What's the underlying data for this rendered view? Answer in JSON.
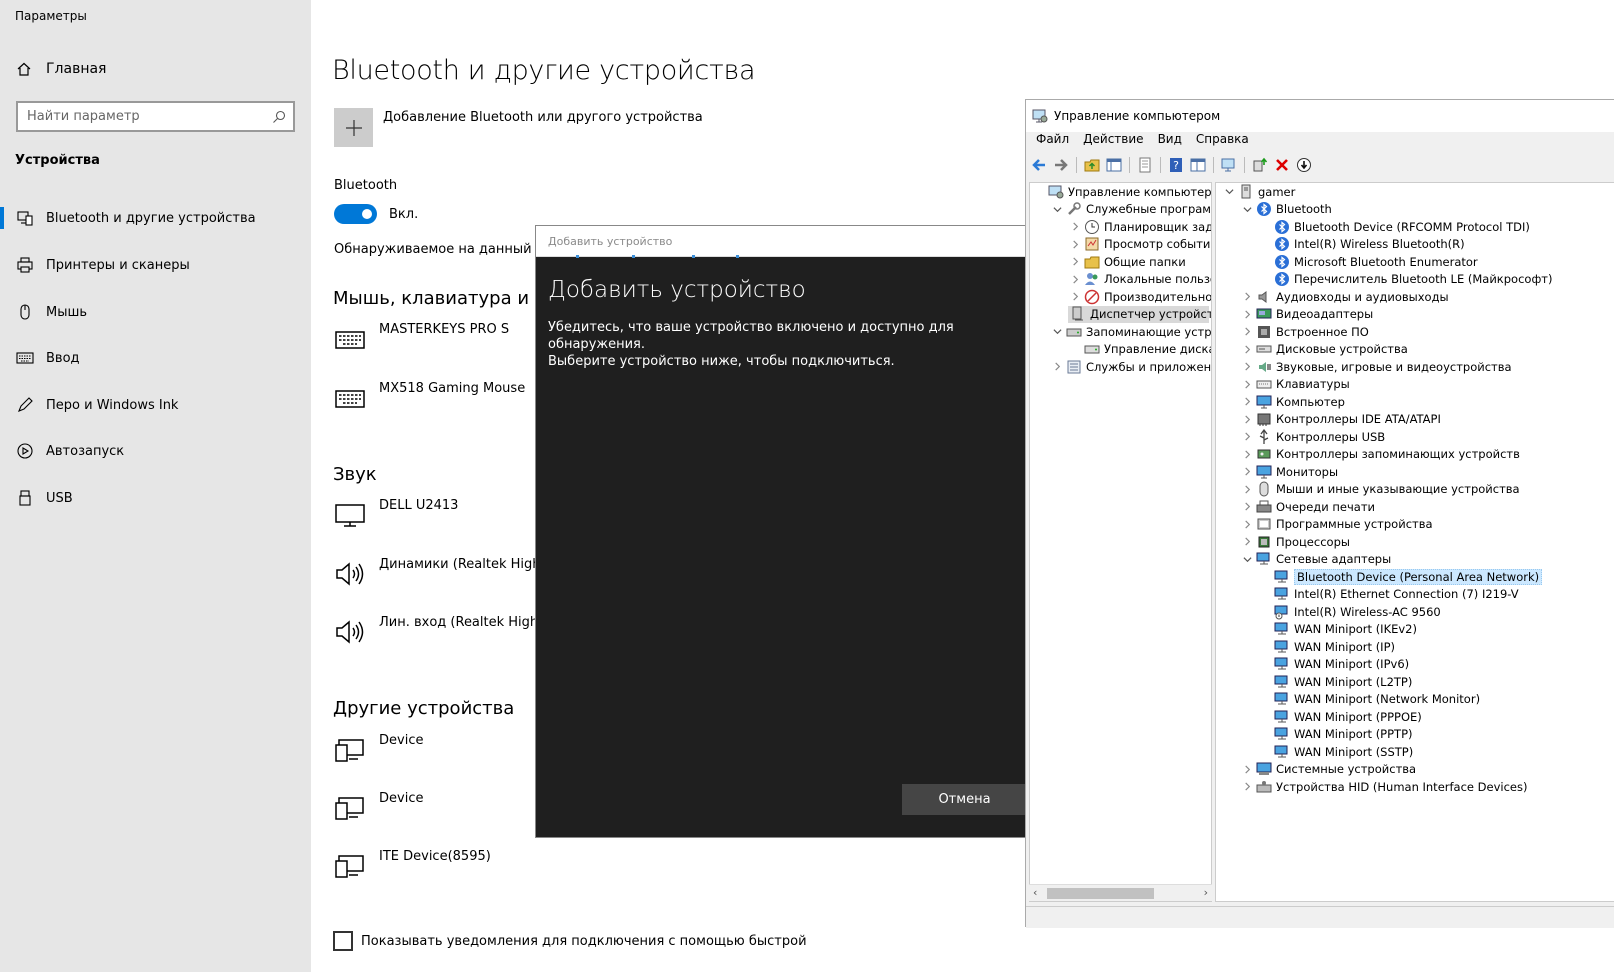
{
  "settings": {
    "app_title": "Параметры",
    "home_label": "Главная",
    "search_placeholder": "Найти параметр",
    "section_label": "Устройства",
    "nav": [
      {
        "label": "Bluetooth и другие устройства",
        "icon": "bluetooth-devices-icon",
        "active": true
      },
      {
        "label": "Принтеры и сканеры",
        "icon": "printer-icon",
        "active": false
      },
      {
        "label": "Мышь",
        "icon": "mouse-icon",
        "active": false
      },
      {
        "label": "Ввод",
        "icon": "keyboard-icon",
        "active": false
      },
      {
        "label": "Перо и Windows Ink",
        "icon": "pen-icon",
        "active": false
      },
      {
        "label": "Автозапуск",
        "icon": "autoplay-icon",
        "active": false
      },
      {
        "label": "USB",
        "icon": "usb-icon",
        "active": false
      }
    ],
    "page_title": "Bluetooth и другие устройства",
    "add_device_label": "Добавление Bluetooth или другого устройства",
    "bluetooth_label": "Bluetooth",
    "bluetooth_state": "Вкл.",
    "discoverable_text": "Обнаруживаемое на данный мо",
    "sections": {
      "input": {
        "title": "Мышь, клавиатура и пе",
        "devices": [
          "MASTERKEYS PRO S",
          "MX518 Gaming Mouse"
        ]
      },
      "audio": {
        "title": "Звук",
        "devices": [
          "DELL U2413",
          "Динамики (Realtek High D",
          "Лин. вход (Realtek High D"
        ]
      },
      "other": {
        "title": "Другие устройства",
        "devices": [
          "Device",
          "Device",
          "ITE Device(8595)"
        ]
      }
    },
    "checkbox_label": "Показывать уведомления для подключения с помощью быстрой"
  },
  "dialog": {
    "window_title": "Добавить устройство",
    "title": "Добавить устройство",
    "text_line1": "Убедитесь, что ваше устройство включено и доступно для обнаружения.",
    "text_line2": "Выберите устройство ниже, чтобы подключиться.",
    "cancel_label": "Отмена"
  },
  "mmc": {
    "window_title": "Управление компьютером",
    "menu": [
      "Файл",
      "Действие",
      "Вид",
      "Справка"
    ],
    "left_tree": [
      {
        "label": "Управление компьютером (л",
        "level": 0,
        "expander": "",
        "icon": "computer-management-icon"
      },
      {
        "label": "Служебные программы",
        "level": 1,
        "expander": "v",
        "icon": "tools-icon"
      },
      {
        "label": "Планировщик заданий",
        "level": 2,
        "expander": ">",
        "icon": "clock-icon"
      },
      {
        "label": "Просмотр событий",
        "level": 2,
        "expander": ">",
        "icon": "event-viewer-icon"
      },
      {
        "label": "Общие папки",
        "level": 2,
        "expander": ">",
        "icon": "shared-folder-icon"
      },
      {
        "label": "Локальные пользовате",
        "level": 2,
        "expander": ">",
        "icon": "users-icon"
      },
      {
        "label": "Производительность",
        "level": 2,
        "expander": ">",
        "icon": "performance-icon"
      },
      {
        "label": "Диспетчер устройств",
        "level": 2,
        "expander": "",
        "icon": "device-manager-icon",
        "selected": true
      },
      {
        "label": "Запоминающие устройст",
        "level": 1,
        "expander": "v",
        "icon": "storage-icon"
      },
      {
        "label": "Управление дисками",
        "level": 2,
        "expander": "",
        "icon": "disk-icon"
      },
      {
        "label": "Службы и приложения",
        "level": 1,
        "expander": ">",
        "icon": "services-icon"
      }
    ],
    "right_tree": [
      {
        "label": "gamer",
        "level": 0,
        "expander": "v",
        "icon": "computer-icon"
      },
      {
        "label": "Bluetooth",
        "level": 1,
        "expander": "v",
        "icon": "bluetooth-icon"
      },
      {
        "label": "Bluetooth Device (RFCOMM Protocol TDI)",
        "level": 2,
        "expander": "",
        "icon": "bluetooth-icon"
      },
      {
        "label": "Intel(R) Wireless Bluetooth(R)",
        "level": 2,
        "expander": "",
        "icon": "bluetooth-icon"
      },
      {
        "label": "Microsoft Bluetooth Enumerator",
        "level": 2,
        "expander": "",
        "icon": "bluetooth-icon"
      },
      {
        "label": "Перечислитель Bluetooth LE (Майкрософт)",
        "level": 2,
        "expander": "",
        "icon": "bluetooth-icon"
      },
      {
        "label": "Аудиовходы и аудиовыходы",
        "level": 1,
        "expander": ">",
        "icon": "audio-icon"
      },
      {
        "label": "Видеоадаптеры",
        "level": 1,
        "expander": ">",
        "icon": "display-adapter-icon"
      },
      {
        "label": "Встроенное ПО",
        "level": 1,
        "expander": ">",
        "icon": "firmware-icon"
      },
      {
        "label": "Дисковые устройства",
        "level": 1,
        "expander": ">",
        "icon": "disk-drive-icon"
      },
      {
        "label": "Звуковые, игровые и видеоустройства",
        "level": 1,
        "expander": ">",
        "icon": "sound-icon"
      },
      {
        "label": "Клавиатуры",
        "level": 1,
        "expander": ">",
        "icon": "keyboard-icon"
      },
      {
        "label": "Компьютер",
        "level": 1,
        "expander": ">",
        "icon": "monitor-icon"
      },
      {
        "label": "Контроллеры IDE ATA/ATAPI",
        "level": 1,
        "expander": ">",
        "icon": "ide-icon"
      },
      {
        "label": "Контроллеры USB",
        "level": 1,
        "expander": ">",
        "icon": "usb-icon"
      },
      {
        "label": "Контроллеры запоминающих устройств",
        "level": 1,
        "expander": ">",
        "icon": "storage-controller-icon"
      },
      {
        "label": "Мониторы",
        "level": 1,
        "expander": ">",
        "icon": "monitor-icon"
      },
      {
        "label": "Мыши и иные указывающие устройства",
        "level": 1,
        "expander": ">",
        "icon": "mouse-icon"
      },
      {
        "label": "Очереди печати",
        "level": 1,
        "expander": ">",
        "icon": "printer-icon"
      },
      {
        "label": "Программные устройства",
        "level": 1,
        "expander": ">",
        "icon": "software-device-icon"
      },
      {
        "label": "Процессоры",
        "level": 1,
        "expander": ">",
        "icon": "processor-icon"
      },
      {
        "label": "Сетевые адаптеры",
        "level": 1,
        "expander": "v",
        "icon": "network-icon"
      },
      {
        "label": "Bluetooth Device (Personal Area Network)",
        "level": 2,
        "expander": "",
        "icon": "network-icon",
        "selected": true
      },
      {
        "label": "Intel(R) Ethernet Connection (7) I219-V",
        "level": 2,
        "expander": "",
        "icon": "network-icon"
      },
      {
        "label": "Intel(R) Wireless-AC 9560",
        "level": 2,
        "expander": "",
        "icon": "network-warning-icon"
      },
      {
        "label": "WAN Miniport (IKEv2)",
        "level": 2,
        "expander": "",
        "icon": "network-icon"
      },
      {
        "label": "WAN Miniport (IP)",
        "level": 2,
        "expander": "",
        "icon": "network-icon"
      },
      {
        "label": "WAN Miniport (IPv6)",
        "level": 2,
        "expander": "",
        "icon": "network-icon"
      },
      {
        "label": "WAN Miniport (L2TP)",
        "level": 2,
        "expander": "",
        "icon": "network-icon"
      },
      {
        "label": "WAN Miniport (Network Monitor)",
        "level": 2,
        "expander": "",
        "icon": "network-icon"
      },
      {
        "label": "WAN Miniport (PPPOE)",
        "level": 2,
        "expander": "",
        "icon": "network-icon"
      },
      {
        "label": "WAN Miniport (PPTP)",
        "level": 2,
        "expander": "",
        "icon": "network-icon"
      },
      {
        "label": "WAN Miniport (SSTP)",
        "level": 2,
        "expander": "",
        "icon": "network-icon"
      },
      {
        "label": "Системные устройства",
        "level": 1,
        "expander": ">",
        "icon": "system-devices-icon"
      },
      {
        "label": "Устройства HID (Human Interface Devices)",
        "level": 1,
        "expander": ">",
        "icon": "hid-icon"
      }
    ]
  },
  "colors": {
    "accent": "#0078d7",
    "sidebar_bg": "#e6e6e6",
    "dialog_bg": "#1f1f1f",
    "selection": "#cce8ff"
  }
}
